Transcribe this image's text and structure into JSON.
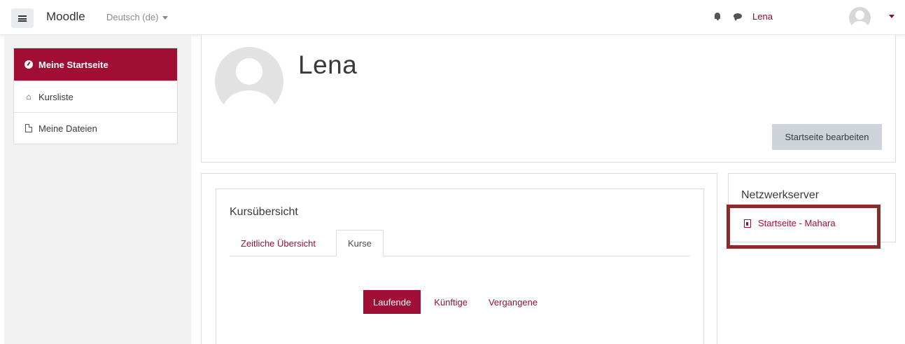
{
  "navbar": {
    "brand": "Moodle",
    "language": "Deutsch (de)",
    "username": "Lena",
    "icons": [
      "menu-icon",
      "bell-icon",
      "chat-icon",
      "avatar-icon",
      "caret-down-icon"
    ]
  },
  "drawer": {
    "items": [
      {
        "label": "Meine Startseite",
        "icon": "dashboard-icon",
        "active": true
      },
      {
        "label": "Kursliste",
        "icon": "home-icon",
        "active": false
      },
      {
        "label": "Meine Dateien",
        "icon": "file-icon",
        "active": false
      }
    ]
  },
  "header": {
    "name": "Lena",
    "edit_button": "Startseite bearbeiten"
  },
  "course_overview": {
    "title": "Kursübersicht",
    "tabs": [
      {
        "label": "Zeitliche Übersicht",
        "active": false
      },
      {
        "label": "Kurse",
        "active": true
      }
    ],
    "filters": [
      {
        "label": "Laufende",
        "active": true
      },
      {
        "label": "Künftige",
        "active": false
      },
      {
        "label": "Vergangene",
        "active": false
      }
    ]
  },
  "network_block": {
    "title": "Netzwerkserver",
    "link": "Startseite - Mahara"
  },
  "colors": {
    "accent": "#a00e36",
    "highlight_border": "#8b2c2c",
    "drawer_bg": "#f2f2f2",
    "button_bg": "#ced4da"
  }
}
